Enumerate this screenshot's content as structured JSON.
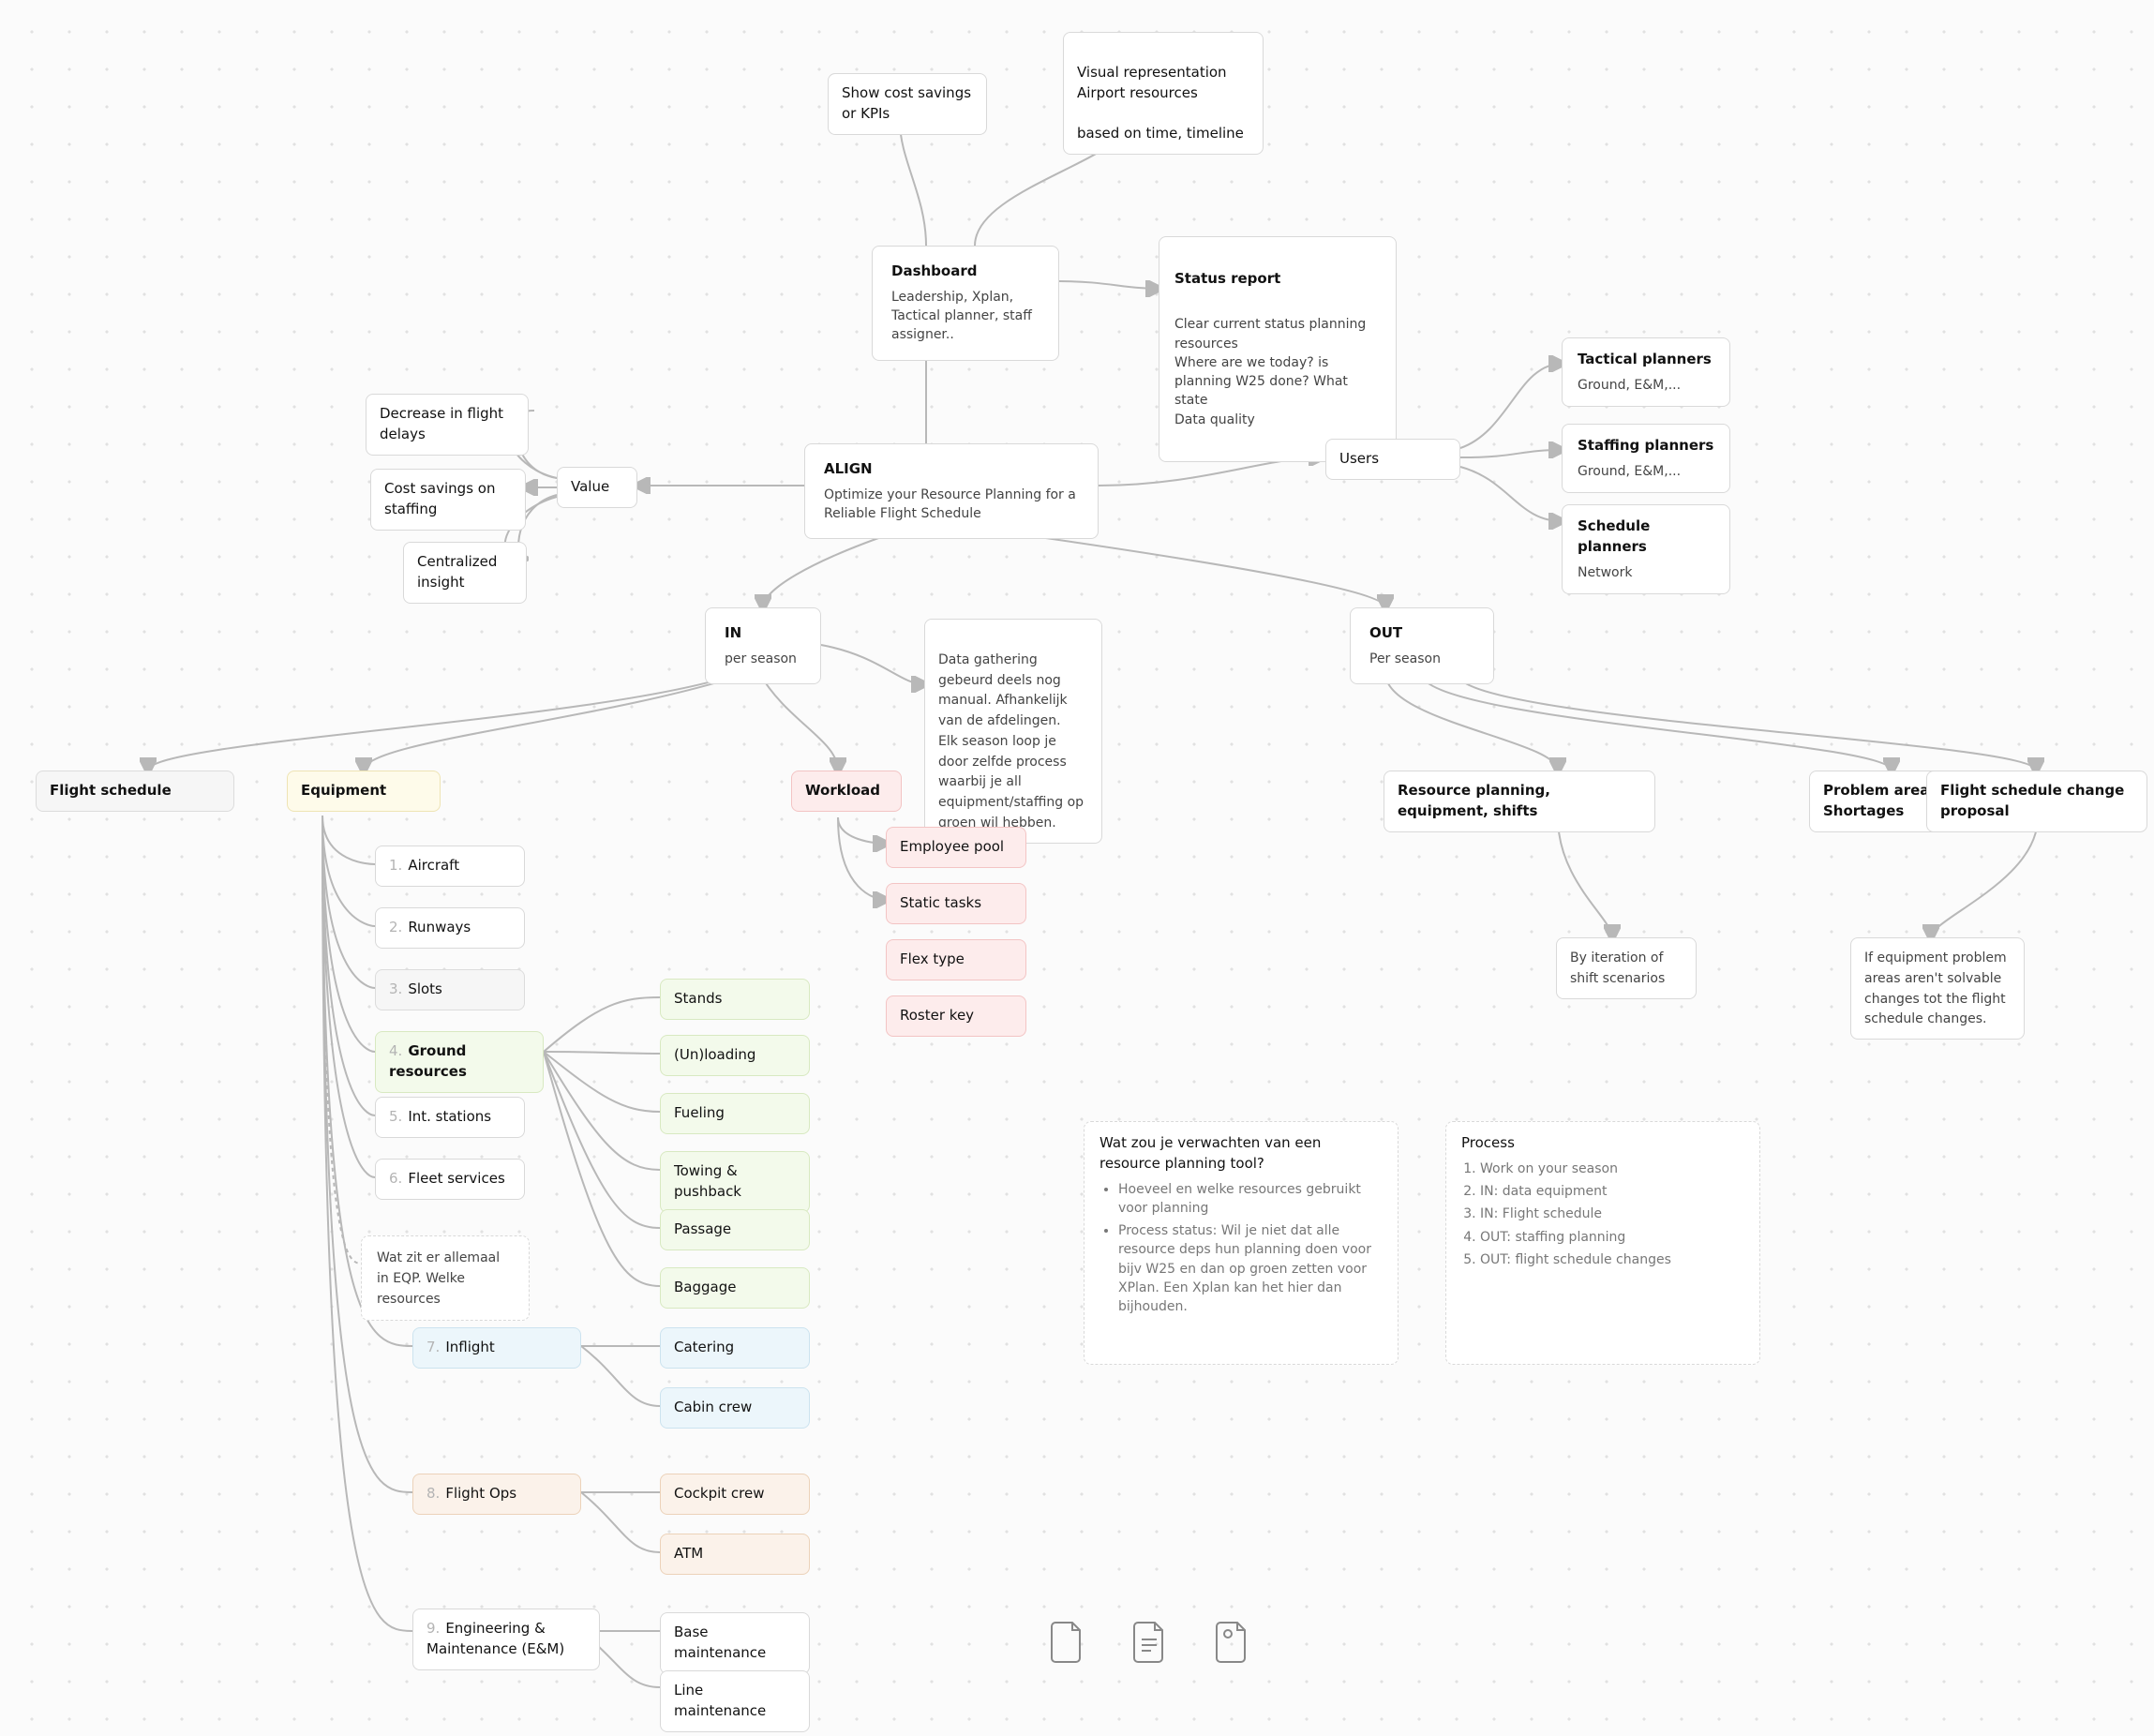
{
  "align": {
    "title": "ALIGN",
    "body": "Optimize your Resource Planning for a Reliable Flight Schedule"
  },
  "dashboard": {
    "title": "Dashboard",
    "body": "Leadership, Xplan, Tactical planner, staff assigner.."
  },
  "kpi": "Show cost savings or KPIs",
  "visual": "Visual representation Airport resources\n\nbased on time, timeline",
  "status": {
    "title": "Status report",
    "body": "Clear current status planning resources\nWhere are we today? is planning W25 done? What state\nData quality"
  },
  "users": {
    "title": "Users"
  },
  "tactical": {
    "title": "Tactical planners",
    "body": "Ground, E&M,..."
  },
  "staffing": {
    "title": "Staffing planners",
    "body": "Ground, E&M,..."
  },
  "scheduleP": {
    "title": "Schedule planners",
    "body": "Network"
  },
  "value": "Value",
  "delays": "Decrease in flight delays",
  "costSav": "Cost savings on staffing",
  "central": "Centralized insight",
  "in": {
    "title": "IN",
    "body": "per season"
  },
  "out": {
    "title": "OUT",
    "body": "Per season"
  },
  "dataGather": "Data gathering gebeurd deels nog manual. Afhankelijk van de afdelingen.\nElk season loop je door zelfde process waarbij je all equipment/staffing op groen wil hebben.",
  "flightSched": "Flight schedule",
  "equipment": "Equipment",
  "workload": "Workload",
  "empPool": "Employee pool",
  "staticTasks": "Static tasks",
  "flexType": "Flex type",
  "rosterKey": "Roster key",
  "eq": {
    "aircraft": {
      "n": "1.",
      "l": "Aircraft"
    },
    "runways": {
      "n": "2.",
      "l": "Runways"
    },
    "slots": {
      "n": "3.",
      "l": "Slots"
    },
    "ground": {
      "n": "4.",
      "l": "Ground resources"
    },
    "intl": {
      "n": "5.",
      "l": "Int. stations"
    },
    "fleet": {
      "n": "6.",
      "l": "Fleet services"
    },
    "inflight": {
      "n": "7.",
      "l": "Inflight"
    },
    "flightops": {
      "n": "8.",
      "l": "Flight Ops"
    },
    "em": {
      "n": "9.",
      "l": "Engineering & Maintenance (E&M)"
    }
  },
  "eqnote": "Wat zit er allemaal in EQP. Welke resources",
  "gr": {
    "stands": "Stands",
    "unload": "(Un)loading",
    "fuel": "Fueling",
    "tow": "Towing & pushback",
    "pass": "Passage",
    "bag": "Baggage"
  },
  "inf": {
    "cat": "Catering",
    "cabin": "Cabin crew"
  },
  "fo": {
    "cockpit": "Cockpit crew",
    "atm": "ATM"
  },
  "em": {
    "base": "Base maintenance",
    "line": "Line maintenance"
  },
  "rpes": "Resource planning, equipment, shifts",
  "problem": "Problem areas / Shortages",
  "fschange": "Flight schedule change proposal",
  "iter": "By iteration of shift scenarios",
  "ifeq": "If equipment problem areas aren't solvable changes tot the flight schedule changes.",
  "expect": {
    "title": "Wat zou je verwachten van een resource planning tool?",
    "items": [
      "Hoeveel en welke resources gebruikt voor planning",
      "Process status: Wil je niet dat alle resource deps hun planning doen voor bijv W25 en dan op groen zetten voor XPlan. Een Xplan kan het hier dan bijhouden."
    ]
  },
  "process": {
    "title": "Process",
    "items": [
      "Work on your season",
      "IN: data equipment",
      "IN: Flight schedule",
      "OUT: staffing planning",
      "OUT: flight schedule changes"
    ]
  }
}
